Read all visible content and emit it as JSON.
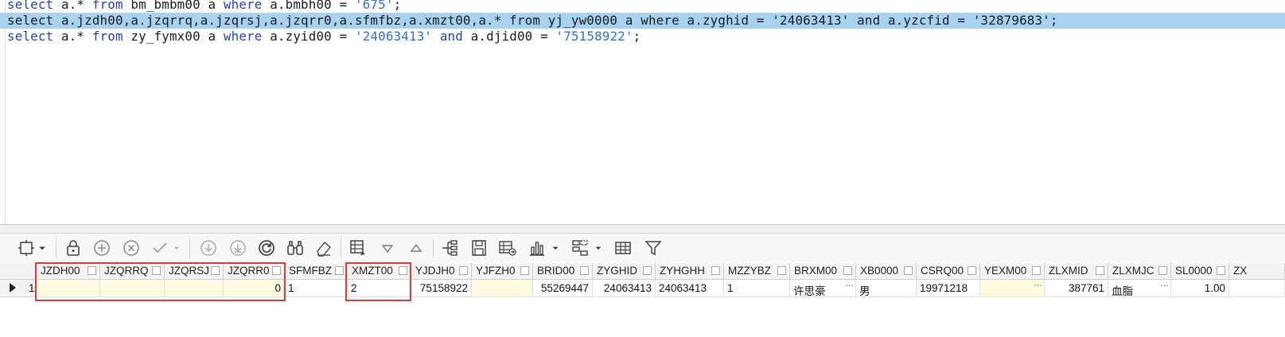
{
  "editor": {
    "lines": [
      {
        "tokens": [
          [
            "kw",
            "select "
          ],
          [
            "txt",
            "a.* "
          ],
          [
            "kw",
            "from "
          ],
          [
            "txt",
            "bm_bmbm00 a "
          ],
          [
            "kw",
            "where "
          ],
          [
            "txt",
            "a.bmbh00 = "
          ],
          [
            "str",
            "'675'"
          ],
          [
            "txt",
            ";"
          ]
        ]
      },
      {
        "tokens": [
          [
            "txt",
            "select a.jzdh00,a.jzqrrq,a.jzqrsj,a.jzqrr0,a.sfmfbz,a.xmzt00,a.* from yj_yw0000 a where a.zyghid = '24063413' and a.yzcfid = '32879683';"
          ]
        ],
        "selected": true
      },
      {
        "tokens": [
          [
            "kw",
            "select "
          ],
          [
            "txt",
            "a.* "
          ],
          [
            "kw",
            "from "
          ],
          [
            "txt",
            "zy_fymx00 a "
          ],
          [
            "kw",
            "where "
          ],
          [
            "txt",
            "a.zyid00 = "
          ],
          [
            "str",
            "'24063413'"
          ],
          [
            "txt",
            " "
          ],
          [
            "kw",
            "and "
          ],
          [
            "txt",
            "a.djid00 = "
          ],
          [
            "str",
            "'75158922'"
          ],
          [
            "txt",
            ";"
          ]
        ]
      }
    ]
  },
  "toolbar": {
    "buttons": [
      "pin-icon",
      "dropdown-arrow-icon",
      "lock-icon",
      "add-row-icon",
      "delete-row-icon",
      "post-check-icon",
      "post-dropdown-icon",
      "move-down-icon",
      "move-down-circle-icon",
      "refresh-icon",
      "find-icon",
      "clear-icon",
      "grid-edit-icon",
      "sort-desc-icon",
      "sort-asc-icon",
      "tree-icon",
      "save-icon",
      "export-icon",
      "chart-icon",
      "chart-dropdown-icon",
      "layout-icon",
      "layout-dropdown-icon",
      "table-icon",
      "filter-icon"
    ]
  },
  "grid": {
    "columns": [
      "JZDH00",
      "JZQRRQ",
      "JZQRSJ",
      "JZQRR0",
      "SFMFBZ",
      "XMZT00",
      "YJDJH0",
      "YJFZH0",
      "BRID00",
      "ZYGHID",
      "ZYHGHH",
      "MZZYBZ",
      "BRXM00",
      "XB0000",
      "CSRQ00",
      "YEXM00",
      "ZLXMID",
      "ZLXMJC",
      "SL0000",
      "ZX"
    ],
    "rows": [
      {
        "index": "1",
        "cells": [
          "",
          "",
          "",
          "0",
          "1",
          "2",
          "75158922",
          "",
          "55269447",
          "24063413",
          "24063413",
          "1",
          "许思豪",
          "男",
          "19971218",
          "",
          "387761",
          "血脂",
          "1.00",
          ""
        ]
      }
    ]
  },
  "colors": {
    "selection": "#a8d3f0",
    "highlight_box": "#e53935",
    "keyword": "#1f3fc7",
    "string": "#2e6fd6"
  }
}
